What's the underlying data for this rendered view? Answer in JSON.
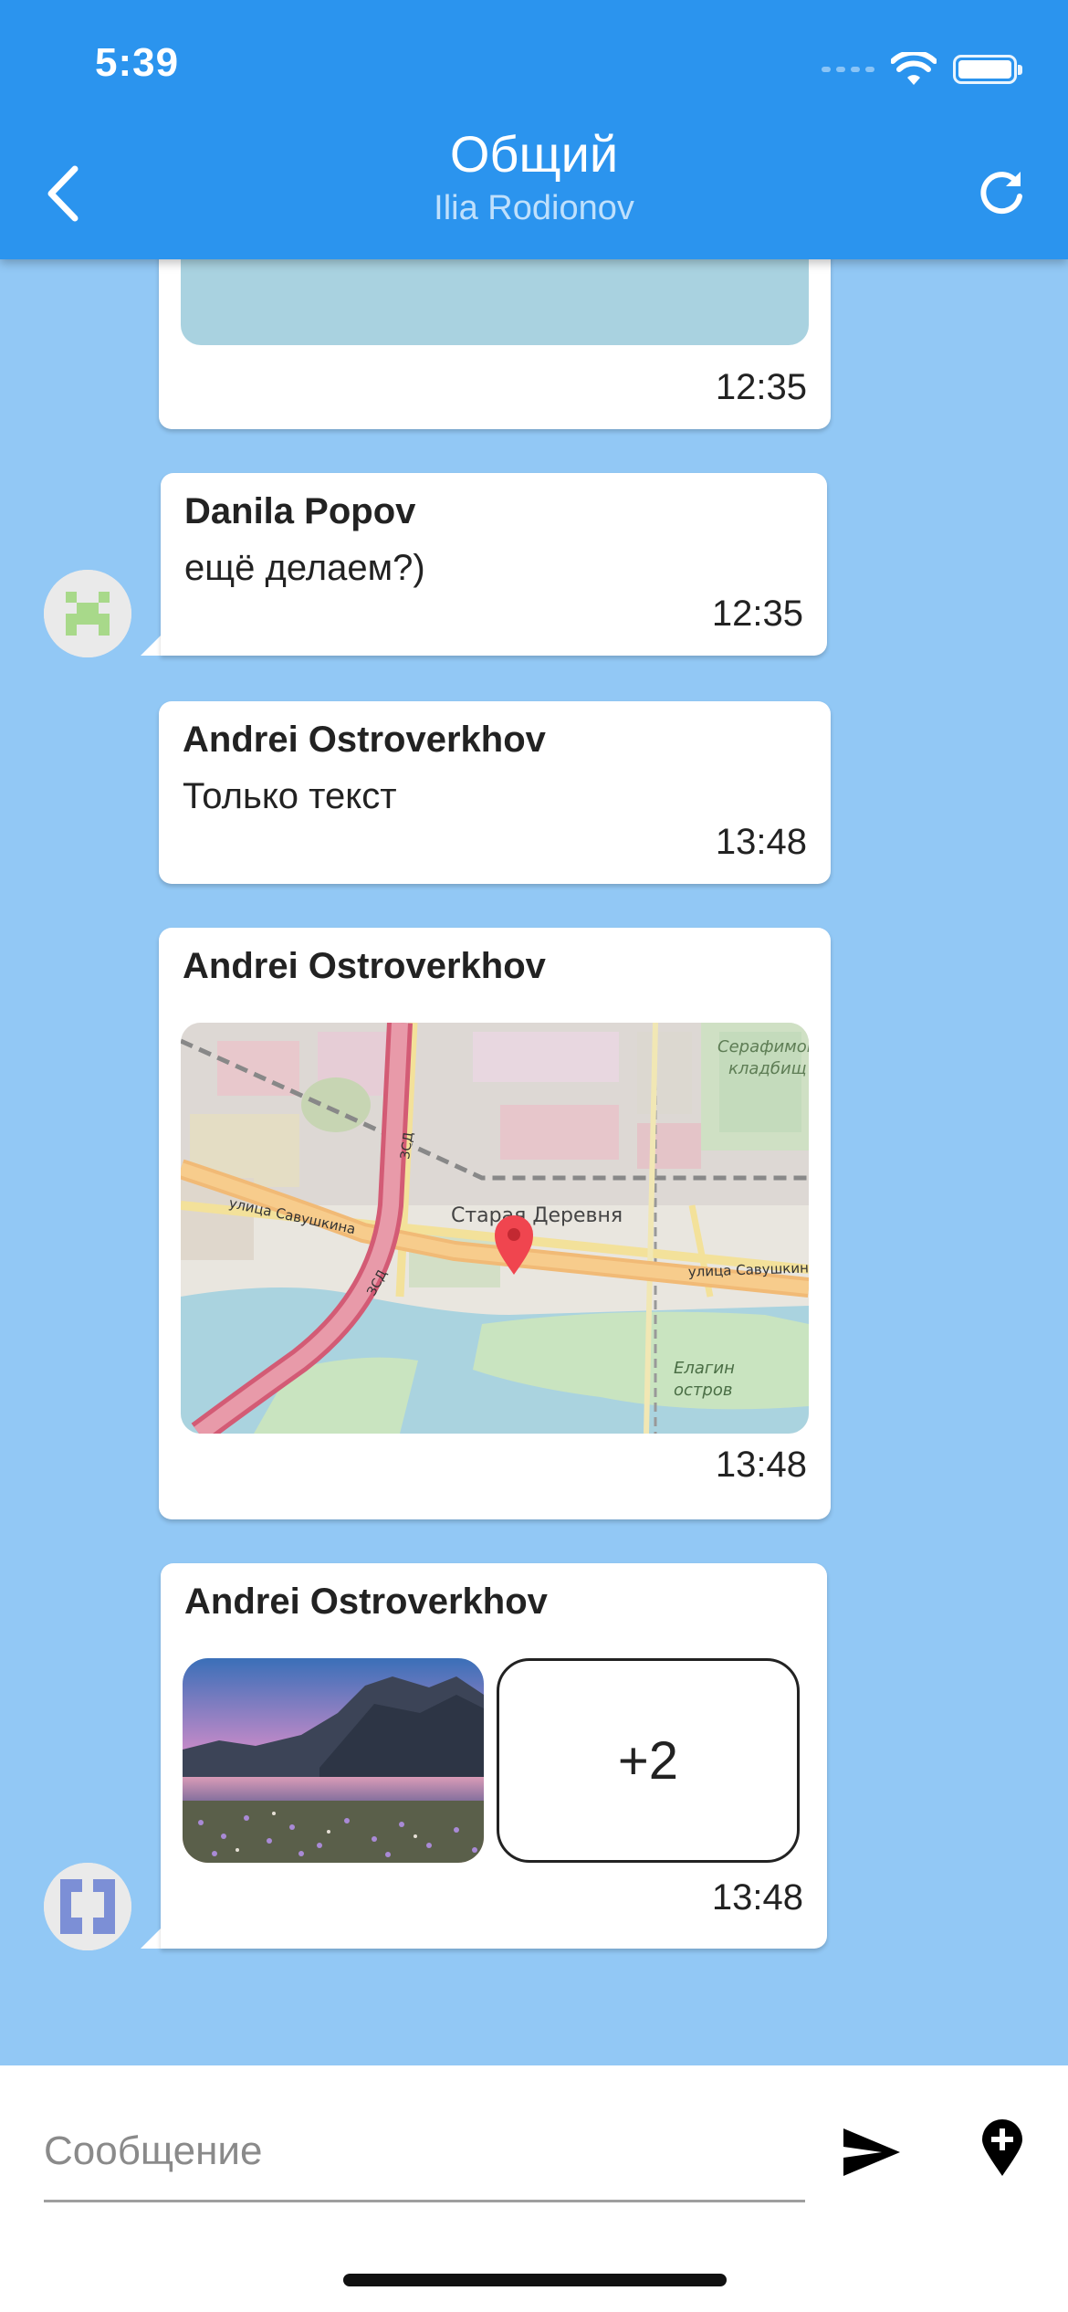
{
  "status_bar": {
    "time": "5:39"
  },
  "header": {
    "title": "Общий",
    "subtitle": "Ilia Rodionov",
    "colors": {
      "bar": "#2b94ee",
      "subtitle": "#bfe0fc"
    }
  },
  "chat_background": "#92c8f5",
  "messages": [
    {
      "kind": "image-partial",
      "time": "12:35"
    },
    {
      "kind": "text",
      "sender": "Danila Popov",
      "text": "ещё делаем?)",
      "time": "12:35",
      "avatar": "pixel-avatar-green"
    },
    {
      "kind": "text",
      "sender": "Andrei Ostroverkhov",
      "text": "Только текст",
      "time": "13:48"
    },
    {
      "kind": "map",
      "sender": "Andrei Ostroverkhov",
      "time": "13:48",
      "map_labels": {
        "road_zsd_1": "ЗСД",
        "road_zsd_2": "ЗСД",
        "district": "Старая Деревня",
        "street_left": "улица Савушкина",
        "street_right": "улица Савушкина",
        "cemetery_1": "Серафимов",
        "cemetery_2": "кладбищ",
        "island_1": "Елагин",
        "island_2": "остров"
      }
    },
    {
      "kind": "gallery",
      "sender": "Andrei Ostroverkhov",
      "more_count": "+2",
      "time": "13:48",
      "avatar": "pixel-avatar-blue"
    }
  ],
  "composer": {
    "placeholder": "Сообщение",
    "value": ""
  },
  "icons": {
    "back": "chevron-left-icon",
    "refresh": "refresh-icon",
    "send": "send-icon",
    "location": "add-location-icon"
  }
}
